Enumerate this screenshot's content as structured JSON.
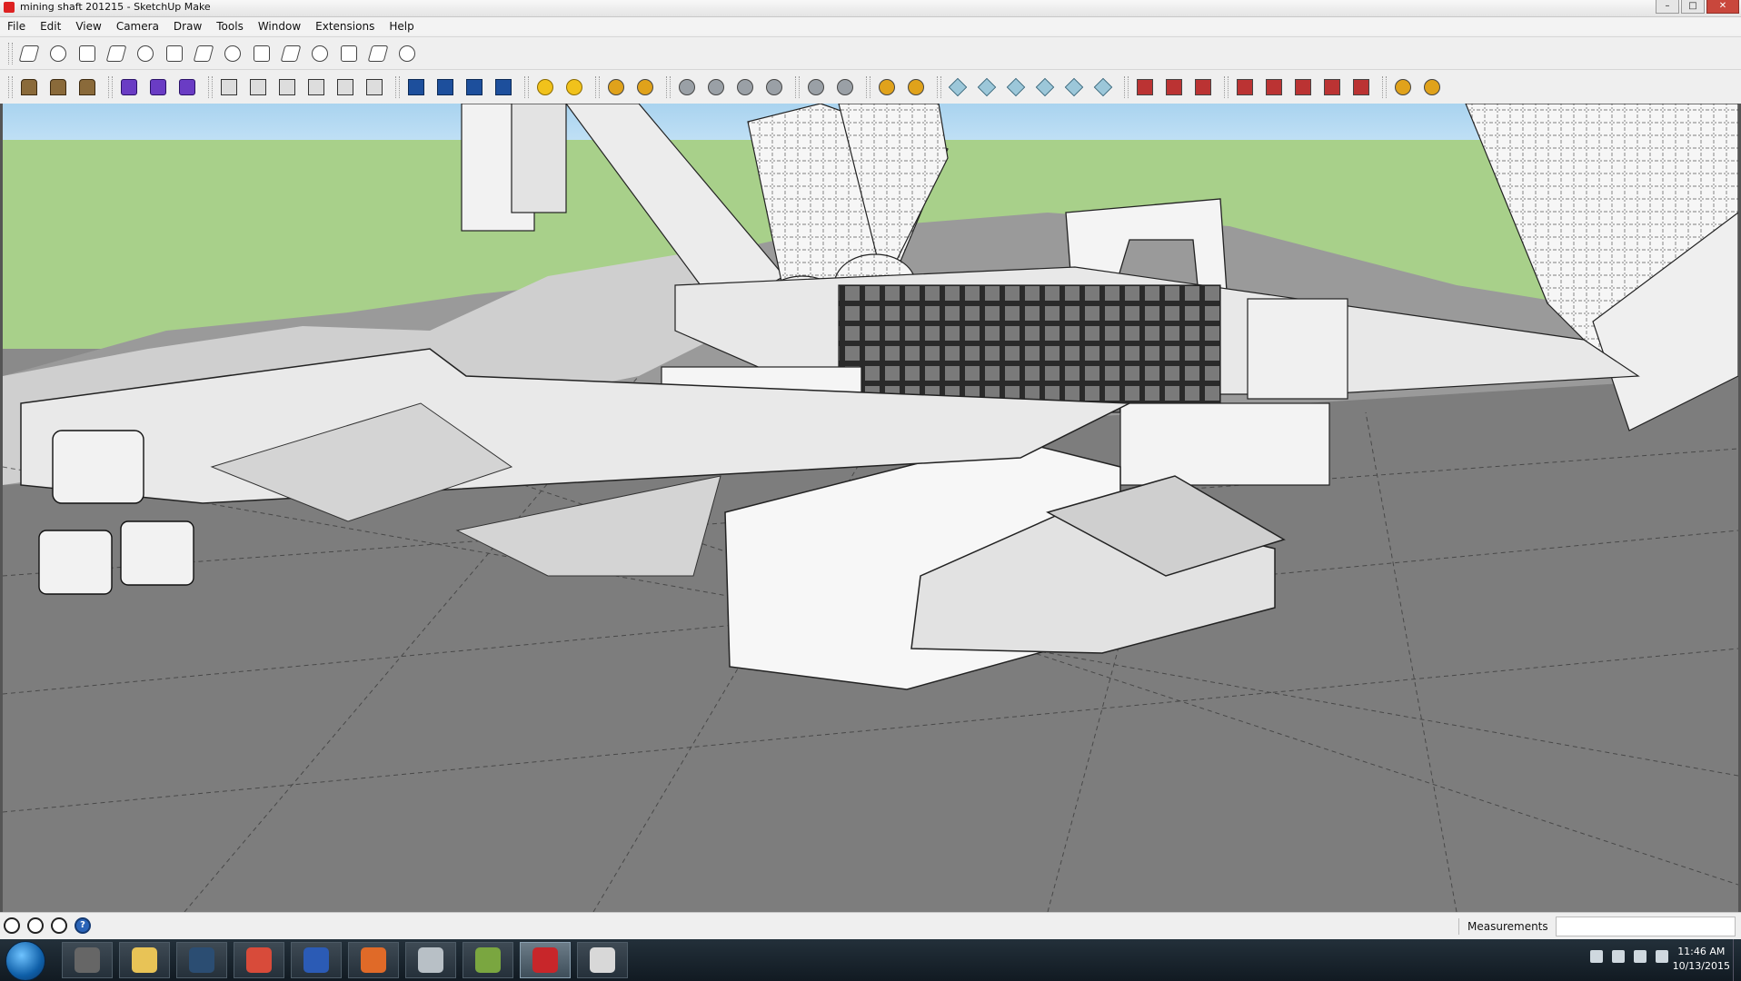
{
  "window": {
    "title": "mining shaft 201215 - SketchUp Make",
    "minimize": "–",
    "maximize": "□",
    "close": "✕"
  },
  "menu": [
    "File",
    "Edit",
    "View",
    "Camera",
    "Draw",
    "Tools",
    "Window",
    "Extensions",
    "Help"
  ],
  "toolbar_row1": {
    "icons": [
      "face-icon",
      "face-icon",
      "face-icon",
      "cone-icon",
      "cylinder-icon",
      "circle-icon",
      "tube-icon",
      "cone-icon",
      "ellipse-icon",
      "ellipse-icon",
      "torus-icon",
      "polyhedron-icon",
      "sphere-icon",
      "sphere-icon"
    ]
  },
  "toolbar_row2": {
    "groups": [
      {
        "style": "solid",
        "icons": [
          "pyramid-icon",
          "sphere-icon",
          "wedge-icon"
        ]
      },
      {
        "style": "purple",
        "icons": [
          "solid-union-icon",
          "solid-subtract-icon",
          "solid-trim-icon"
        ]
      },
      {
        "style": "mono",
        "icons": [
          "cube-icon",
          "cube-wire-icon",
          "pyramid-icon",
          "axes-icon",
          "pencil-icon",
          "stack-icon"
        ]
      },
      {
        "style": "blue",
        "icons": [
          "section-plane-icon",
          "layer-icon",
          "layer-grid-icon",
          "light-icon"
        ]
      },
      {
        "style": "yellow",
        "icons": [
          "ellipse-icon",
          "cone-icon"
        ]
      },
      {
        "style": "misc",
        "icons": [
          "color-blocks-icon",
          "color-dots-icon"
        ]
      },
      {
        "style": "gray",
        "icons": [
          "vray-logo-icon",
          "dome-icon",
          "monitor-icon",
          "paint-icon"
        ]
      },
      {
        "style": "gray",
        "icons": [
          "orbit-icon",
          "tape-icon"
        ]
      },
      {
        "style": "misc",
        "icons": [
          "materials-icon",
          "bulb-icon"
        ]
      },
      {
        "style": "cube",
        "icons": [
          "box-icon",
          "box-icon",
          "box-icon",
          "box-icon",
          "wand-icon",
          "green-box-icon"
        ]
      },
      {
        "style": "tool",
        "icons": [
          "red-tool-icon",
          "blue-tool-icon",
          "green-tool-icon"
        ]
      },
      {
        "style": "tool",
        "icons": [
          "move-icon",
          "scale-icon",
          "rotate-icon",
          "mirror-icon",
          "align-icon"
        ]
      },
      {
        "style": "misc",
        "icons": [
          "compass-icon",
          "tools-icon"
        ]
      }
    ]
  },
  "status": {
    "measurements_label": "Measurements",
    "measurements_value": "",
    "help_label": "?"
  },
  "taskbar": {
    "apps": [
      {
        "name": "obs-icon",
        "color": "#666"
      },
      {
        "name": "explorer-icon",
        "color": "#e8c356"
      },
      {
        "name": "steam-icon",
        "color": "#2b4d72"
      },
      {
        "name": "chrome-icon",
        "color": "#d84b3a"
      },
      {
        "name": "word-icon",
        "color": "#2b5bb5"
      },
      {
        "name": "media-icon",
        "color": "#e06a28"
      },
      {
        "name": "disc-icon",
        "color": "#b8c0c6"
      },
      {
        "name": "app-icon",
        "color": "#7aa640"
      },
      {
        "name": "sketchup-icon",
        "color": "#c8262a"
      },
      {
        "name": "paint-icon",
        "color": "#d8d8d8"
      }
    ],
    "time": "11:46 AM",
    "date": "10/13/2015"
  }
}
